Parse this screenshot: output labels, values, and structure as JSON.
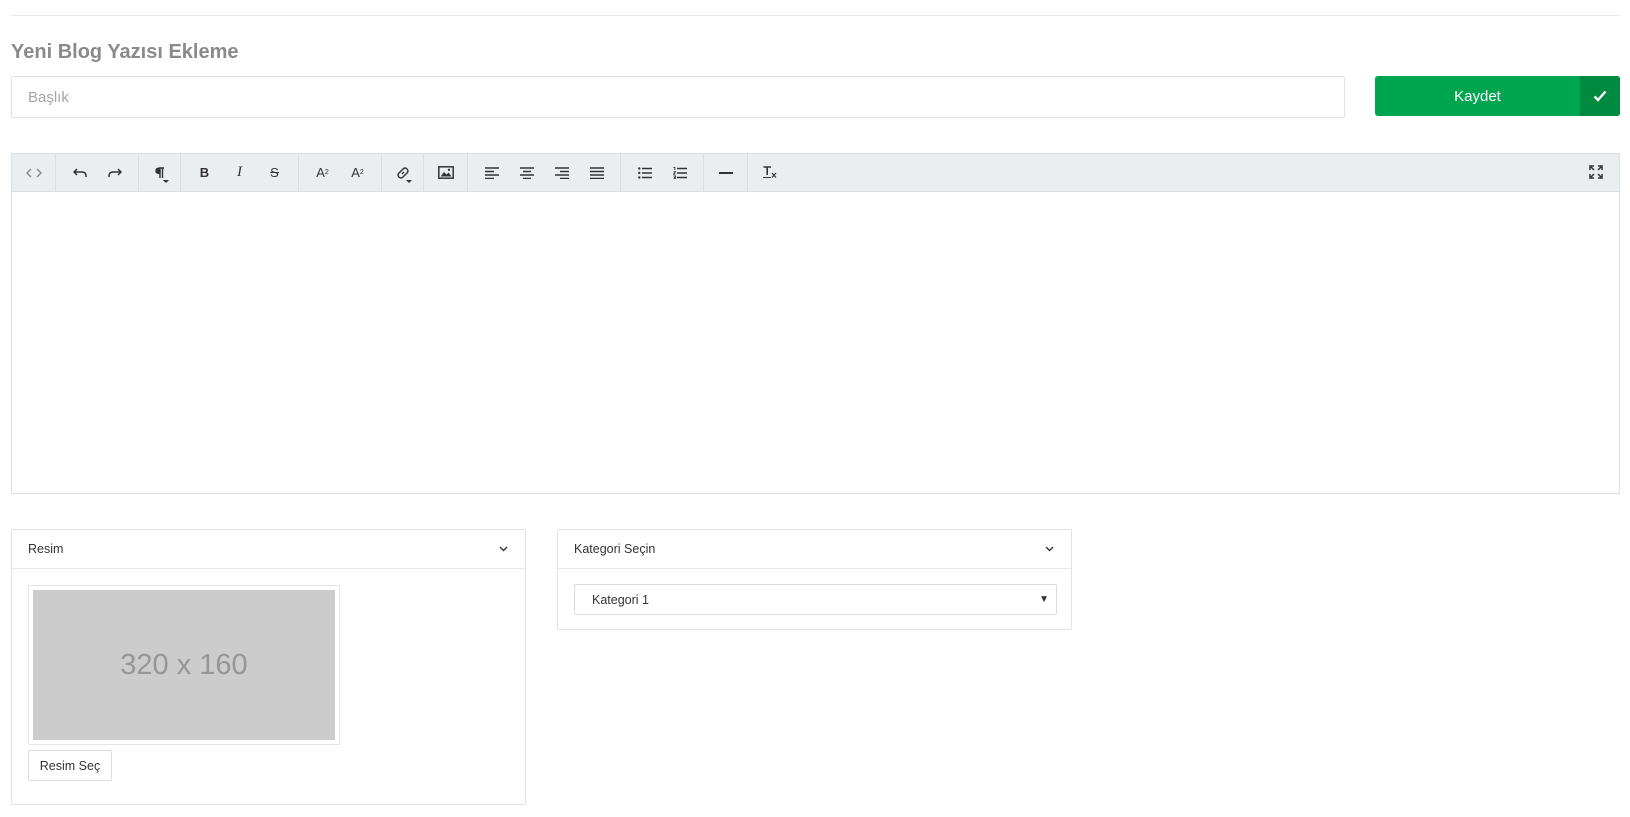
{
  "page": {
    "title": "Yeni Blog Yazısı Ekleme"
  },
  "form": {
    "title_placeholder": "Başlık",
    "title_value": ""
  },
  "save_button": {
    "label": "Kaydet",
    "color": "#00a54f",
    "icon": "check-icon"
  },
  "editor": {
    "toolbar_groups": [
      [
        "code-view-icon"
      ],
      [
        "undo-icon",
        "redo-icon"
      ],
      [
        "paragraph-format-icon"
      ],
      [
        "bold-icon",
        "italic-icon",
        "strikethrough-icon"
      ],
      [
        "superscript-icon",
        "subscript-icon"
      ],
      [
        "insert-link-icon"
      ],
      [
        "insert-image-icon"
      ],
      [
        "align-left-icon",
        "align-center-icon",
        "align-right-icon",
        "align-justify-icon"
      ],
      [
        "unordered-list-icon",
        "ordered-list-icon"
      ],
      [
        "horizontal-rule-icon"
      ],
      [
        "clear-formatting-icon"
      ]
    ],
    "fullscreen_icon": "fullscreen-icon",
    "content": ""
  },
  "image_panel": {
    "title": "Resim",
    "placeholder_text": "320 x 160",
    "select_button": "Resim Seç"
  },
  "category_panel": {
    "title": "Kategori Seçin",
    "selected": "Kategori 1"
  }
}
